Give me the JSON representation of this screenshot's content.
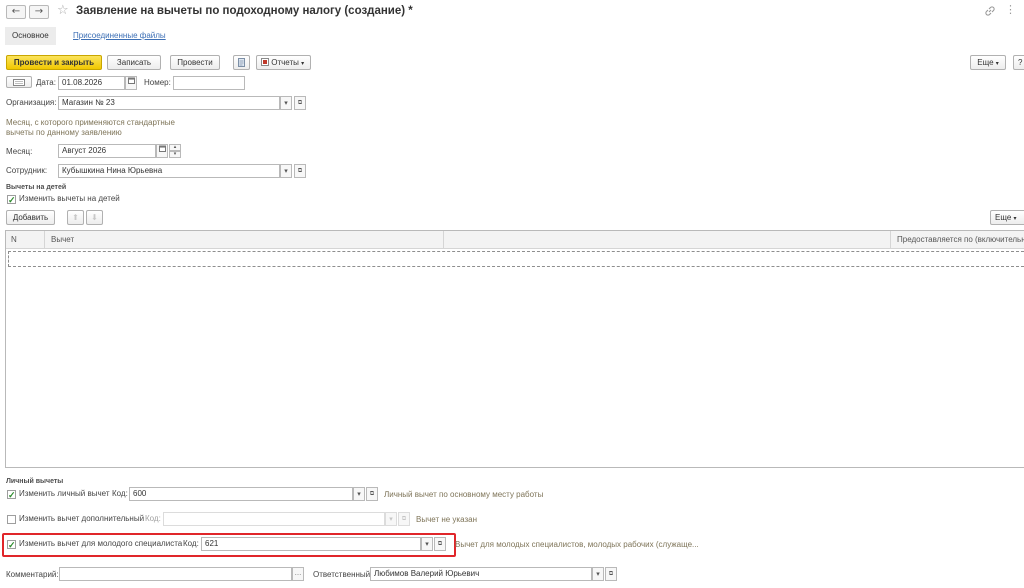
{
  "window": {
    "title": "Заявление на вычеты по подоходному налогу (создание) *",
    "back_icon": "←",
    "forward_icon": "→",
    "star_icon": "☆",
    "link_icon": "🔗",
    "more_icon": "⋮"
  },
  "tabs": [
    {
      "label": "Основное",
      "active": true
    },
    {
      "label": "Присоединенные файлы",
      "active": false
    }
  ],
  "toolbar": {
    "post_and_close": "Провести и закрыть",
    "save": "Записать",
    "post": "Провести",
    "reports": "Отчеты",
    "more": "Еще",
    "help": "?"
  },
  "header": {
    "date_label": "Дата:",
    "date_value": "01.08.2026",
    "number_label": "Номер:",
    "number_value": ""
  },
  "organization": {
    "label": "Организация:",
    "value": "Магазин № 23"
  },
  "month_hint": "Месяц, с которого применяются стандартные вычеты по данному заявлению",
  "month": {
    "label": "Месяц:",
    "value": "Август 2026"
  },
  "employee": {
    "label": "Сотрудник:",
    "value": "Кубышкина Нина Юрьевна"
  },
  "children": {
    "section_title": "Вычеты на детей",
    "change_label": "Изменить вычеты на детей",
    "change_checked": true,
    "add_button": "Добавить",
    "more_button": "Еще",
    "columns": [
      "N",
      "Вычет",
      "",
      "Предоставляется по (включительно)"
    ],
    "rows": []
  },
  "personal": {
    "section_title": "Личный вычеты",
    "change_personal_label": "Изменить личный вычет",
    "change_personal_checked": true,
    "personal_code_label": "Код:",
    "personal_code": "600",
    "personal_desc": "Личный вычет по основному месту работы",
    "change_extra_label": "Изменить вычет дополнительный",
    "change_extra_checked": false,
    "extra_code_label": "Код:",
    "extra_code": "",
    "extra_desc": "Вычет не указан",
    "change_young_label": "Изменить вычет для молодого специалиста",
    "change_young_checked": true,
    "young_code_label": "Код:",
    "young_code": "621",
    "young_desc": "Вычет для молодых специалистов, молодых рабочих (служаще..."
  },
  "footer": {
    "comment_label": "Комментарий:",
    "comment_value": "",
    "responsible_label": "Ответственный:",
    "responsible_value": "Любимов Валерий Юрьевич"
  },
  "colors": {
    "primary_button": "#f1c800",
    "link": "#3c6fb5",
    "highlight_border": "#e0262a",
    "checkmark": "#2c8b2c"
  }
}
